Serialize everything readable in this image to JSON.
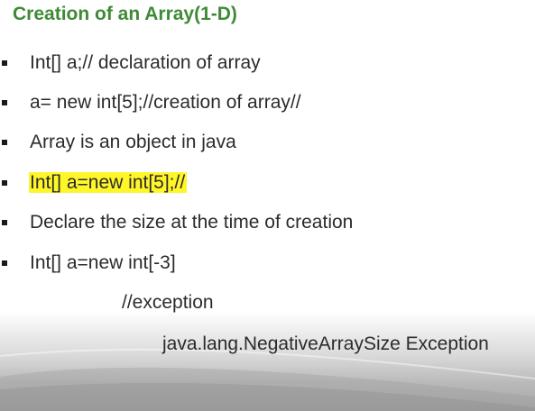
{
  "slide": {
    "title": "Creation of an Array(1-D)",
    "bullets": [
      {
        "text": "Int[] a;// declaration of array",
        "highlighted": false
      },
      {
        "text": "a= new int[5];//creation of array//",
        "highlighted": false
      },
      {
        "text": "Array is an object in java",
        "highlighted": false
      },
      {
        "text": "Int[] a=new int[5];//",
        "highlighted": true
      },
      {
        "text": "Declare the size at the time of creation",
        "highlighted": false
      },
      {
        "text": "Int[] a=new int[-3]",
        "highlighted": false
      }
    ],
    "comment_line": "//exception",
    "exception_line": "java.lang.NegativeArraySize Exception"
  },
  "colors": {
    "title": "#3f8a37",
    "highlight": "#fff62a",
    "text": "#2b2b2b"
  }
}
